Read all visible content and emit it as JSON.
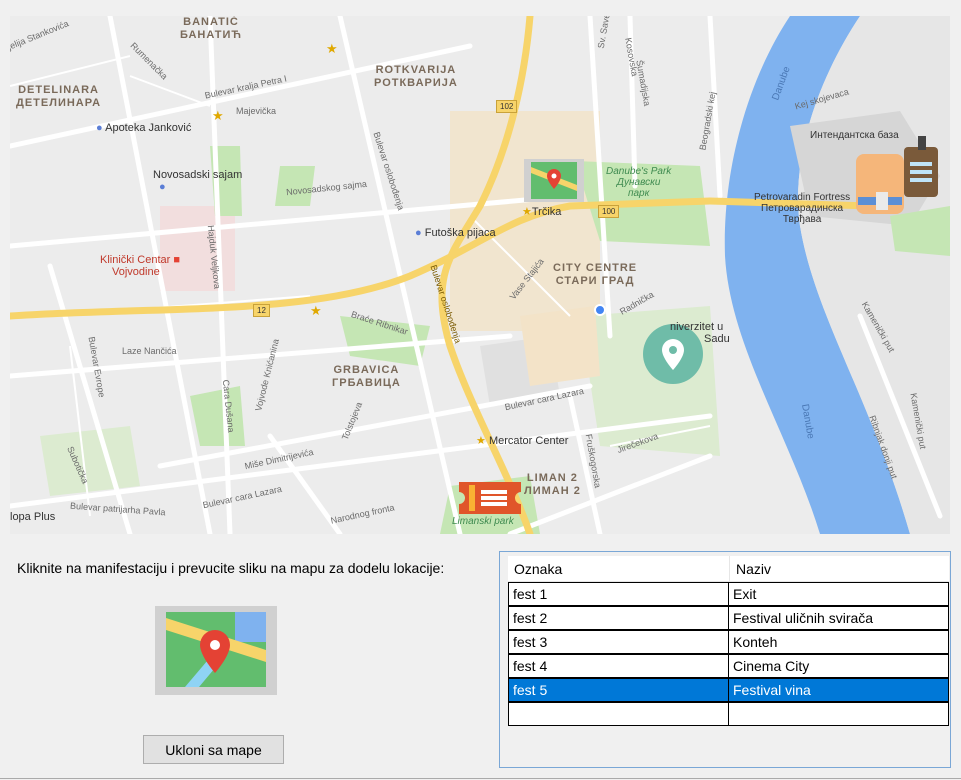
{
  "map": {
    "districts": [
      {
        "lat": "BANATIĆ",
        "cyr": "БАНАТИЋ"
      },
      {
        "lat": "DETELINARA",
        "cyr": "ДЕТЕЛИНАРА"
      },
      {
        "lat": "ROTKVARIJA",
        "cyr": "РОТКВАРИЈА"
      },
      {
        "lat": "CITY CENTRE",
        "cyr": "СТАРИ ГРАД"
      },
      {
        "lat": "GRBAVICA",
        "cyr": "ГРБАВИЦА"
      },
      {
        "lat": "LIMAN 2",
        "cyr": "ЛИМАН 2"
      }
    ],
    "pois": {
      "apoteka": "Apoteka Janković",
      "sajam": "Novosadski sajam",
      "klinicki_1": "Klinički Centar",
      "klinicki_2": "Vojvodine",
      "futoska": "Futoška pijaca",
      "trcika": "Trčika",
      "danube_park_1": "Danube's Park",
      "danube_park_2": "Дунавски",
      "danube_park_3": "парк",
      "univerzitet_1": "niverzitet u",
      "univerzitet_2": "Sadu",
      "mercator": "Mercator Center",
      "fortress_1": "Petrovaradin Fortress",
      "fortress_2": "Петроварадинска",
      "fortress_3": "Тврђава",
      "intendantska": "Интендантска база",
      "limanski": "Limanski park",
      "kopa": "lopa Plus",
      "danube_1": "Danube",
      "danube_2": "Danube"
    },
    "roads": {
      "stankovica": "jelija Stankovića",
      "rumenacka": "Rumenačka",
      "kralja_petra": "Bulevar kralja Petra I",
      "majevicka": "Majevička",
      "novosadskog_sajma": "Novosadskog sajma",
      "bul_osl_1": "Bulevar oslobođenja",
      "bul_osl_2": "Bulevar oslobođenja",
      "hajduk": "Hajduk Veljkova",
      "brace": "Braće Ribnikar",
      "vase": "Vase Stajića",
      "radnicka": "Radnička",
      "beogradski": "Beogradski kej",
      "kej": "Kej skojevaca",
      "bul_evrope": "Bulevar Evrope",
      "laze": "Laze Nančića",
      "vojvode": "Vojvode Knićanina",
      "cara_dusana": "Cara Dušana",
      "cara_lazara_1": "Bulevar cara Lazara",
      "cara_lazara_2": "Bulevar cara Lazara",
      "tolstojeva": "Tolstojeva",
      "mise": "Miše Dimitrijevića",
      "subotica": "Subotička",
      "patrijarha": "Bulevar patrijarha Pavla",
      "narodnog": "Narodnog fronta",
      "jirecekova": "Jirečekova",
      "fruskogorska": "Fruškogorska",
      "sumadijska": "Šumadijska",
      "kosovska": "Kosovska",
      "sv_save": "Sv. Save",
      "kamenicki": "Kamenički put",
      "ribnjak": "Ribnjak donji put",
      "kamenicki_2": "Kamenički put"
    },
    "shields": [
      "102",
      "100",
      "12"
    ]
  },
  "instruction": "Kliknite na manifestaciju i prevucite sliku na mapu za dodelu lokacije:",
  "remove_button": "Ukloni sa mape",
  "table": {
    "columns": [
      "Oznaka",
      "Naziv"
    ],
    "rows": [
      {
        "oznaka": "fest 1",
        "naziv": "Exit"
      },
      {
        "oznaka": "fest 2",
        "naziv": "Festival uličnih svirača"
      },
      {
        "oznaka": "fest 3",
        "naziv": "Konteh"
      },
      {
        "oznaka": "fest 4",
        "naziv": "Cinema City"
      },
      {
        "oznaka": "fest 5",
        "naziv": "Festival vina",
        "selected": true
      },
      {
        "oznaka": "",
        "naziv": ""
      }
    ]
  },
  "colors": {
    "selection": "#0078d7",
    "river": "#7fb2ef",
    "park": "#c5e6b4",
    "road_major": "#f7d46a"
  }
}
